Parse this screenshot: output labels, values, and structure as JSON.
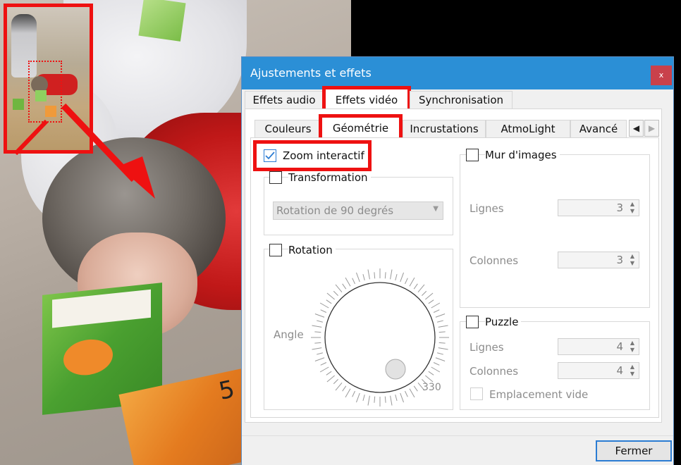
{
  "dialog": {
    "title": "Ajustements et effets",
    "close_glyph": "x",
    "close_label": "Fermer"
  },
  "main_tabs": [
    {
      "label": "Effets audio",
      "active": false
    },
    {
      "label": "Effets vidéo",
      "active": true
    },
    {
      "label": "Synchronisation",
      "active": false
    }
  ],
  "sub_tabs": [
    {
      "label": "Couleurs",
      "active": false
    },
    {
      "label": "Géométrie",
      "active": true
    },
    {
      "label": "Incrustations",
      "active": false
    },
    {
      "label": "AtmoLight",
      "active": false
    },
    {
      "label": "Avancé",
      "active": false
    }
  ],
  "geometry": {
    "zoom": {
      "label": "Zoom interactif",
      "checked": true
    },
    "transformation": {
      "label": "Transformation",
      "checked": false,
      "select_value": "Rotation de 90 degrés"
    },
    "rotation": {
      "label": "Rotation",
      "checked": false,
      "angle_label": "Angle",
      "angle_value": "330"
    },
    "wall": {
      "label": "Mur d'images",
      "checked": false,
      "rows_label": "Lignes",
      "rows_value": "3",
      "cols_label": "Colonnes",
      "cols_value": "3"
    },
    "puzzle": {
      "label": "Puzzle",
      "checked": false,
      "rows_label": "Lignes",
      "rows_value": "4",
      "cols_label": "Colonnes",
      "cols_value": "4",
      "empty_label": "Emplacement vide",
      "empty_checked": false
    }
  },
  "colors": {
    "titlebar": "#2b8fd6",
    "highlight": "#ee1111",
    "accent": "#2b7cd3"
  },
  "icons": {
    "close": "close-icon",
    "check": "checkmark-icon",
    "scroll_left": "triangle-left-icon",
    "scroll_right": "triangle-right-icon",
    "spin_up": "spin-up-icon",
    "spin_down": "spin-down-icon",
    "dropdown": "chevron-down-icon",
    "annotation_arrow": "red-arrow-icon"
  }
}
